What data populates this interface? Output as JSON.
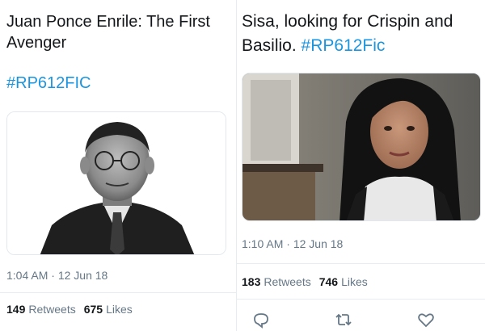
{
  "tweets": [
    {
      "text": "Juan Ponce Enrile: The First Avenger",
      "hashtag": "#RP612FIC",
      "time": "1:04 AM",
      "date": "12 Jun 18",
      "retweets": "149",
      "retweets_label": "Retweets",
      "likes": "675",
      "likes_label": "Likes"
    },
    {
      "text": "Sisa, looking for Crispin and Basilio.",
      "hashtag": "#RP612Fic",
      "time": "1:10 AM",
      "date": "12 Jun 18",
      "retweets": "183",
      "retweets_label": "Retweets",
      "likes": "746",
      "likes_label": "Likes"
    }
  ],
  "separator": "·",
  "actions": [
    "reply-icon",
    "retweet-icon",
    "like-icon"
  ],
  "colors": {
    "link": "#1b95e0",
    "text": "#14171a",
    "muted": "#657786",
    "border": "#e6ecf0"
  }
}
